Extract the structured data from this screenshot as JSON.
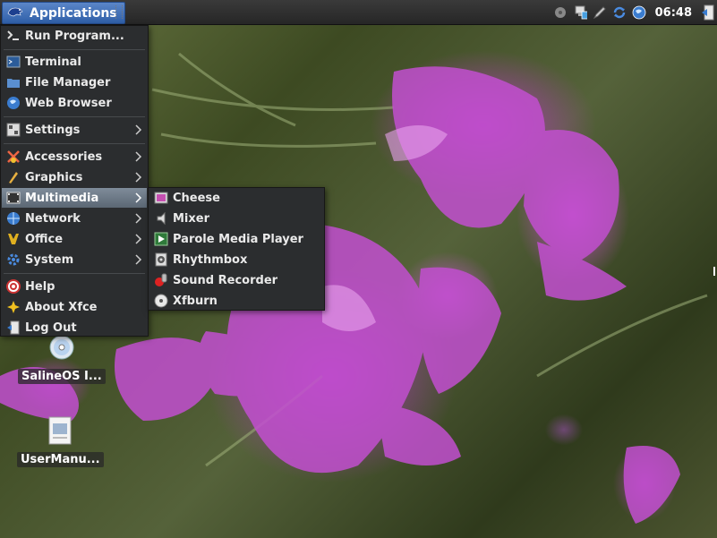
{
  "panel": {
    "applications_label": "Applications",
    "clock": "06:48",
    "tray_icons": [
      "disk-icon",
      "network-icon",
      "pencil-icon",
      "refresh-icon",
      "globe-icon",
      "logout-icon"
    ]
  },
  "main_menu": {
    "items": [
      {
        "label": "Run Program...",
        "icon": "run-icon"
      },
      {
        "label": "Terminal",
        "icon": "terminal-icon"
      },
      {
        "label": "File Manager",
        "icon": "folder-icon"
      },
      {
        "label": "Web Browser",
        "icon": "globe-icon"
      },
      {
        "label": "Settings",
        "icon": "settings-icon",
        "submenu": true
      },
      {
        "label": "Accessories",
        "icon": "accessories-icon",
        "submenu": true
      },
      {
        "label": "Graphics",
        "icon": "graphics-icon",
        "submenu": true
      },
      {
        "label": "Multimedia",
        "icon": "multimedia-icon",
        "submenu": true,
        "active": true
      },
      {
        "label": "Network",
        "icon": "network-icon",
        "submenu": true
      },
      {
        "label": "Office",
        "icon": "office-icon",
        "submenu": true
      },
      {
        "label": "System",
        "icon": "system-icon",
        "submenu": true
      },
      {
        "label": "Help",
        "icon": "help-icon"
      },
      {
        "label": "About Xfce",
        "icon": "star-icon"
      },
      {
        "label": "Log Out",
        "icon": "logout-icon"
      }
    ]
  },
  "multimedia_menu": {
    "items": [
      {
        "label": "Cheese",
        "icon": "cheese-icon"
      },
      {
        "label": "Mixer",
        "icon": "mixer-icon"
      },
      {
        "label": "Parole Media Player",
        "icon": "media-player-icon"
      },
      {
        "label": "Rhythmbox",
        "icon": "rhythmbox-icon"
      },
      {
        "label": "Sound Recorder",
        "icon": "sound-recorder-icon"
      },
      {
        "label": "Xfburn",
        "icon": "disc-burn-icon"
      }
    ]
  },
  "desktop": {
    "icons": [
      {
        "label": "SalineOS I...",
        "icon": "cd-icon"
      },
      {
        "label": "UserManu...",
        "icon": "document-icon"
      }
    ]
  },
  "colors": {
    "menu_bg": "#2b2d2f",
    "menu_active": "#6d7985",
    "panel_bg": "#2e2e2e",
    "apps_button": "#3f6fb8"
  }
}
